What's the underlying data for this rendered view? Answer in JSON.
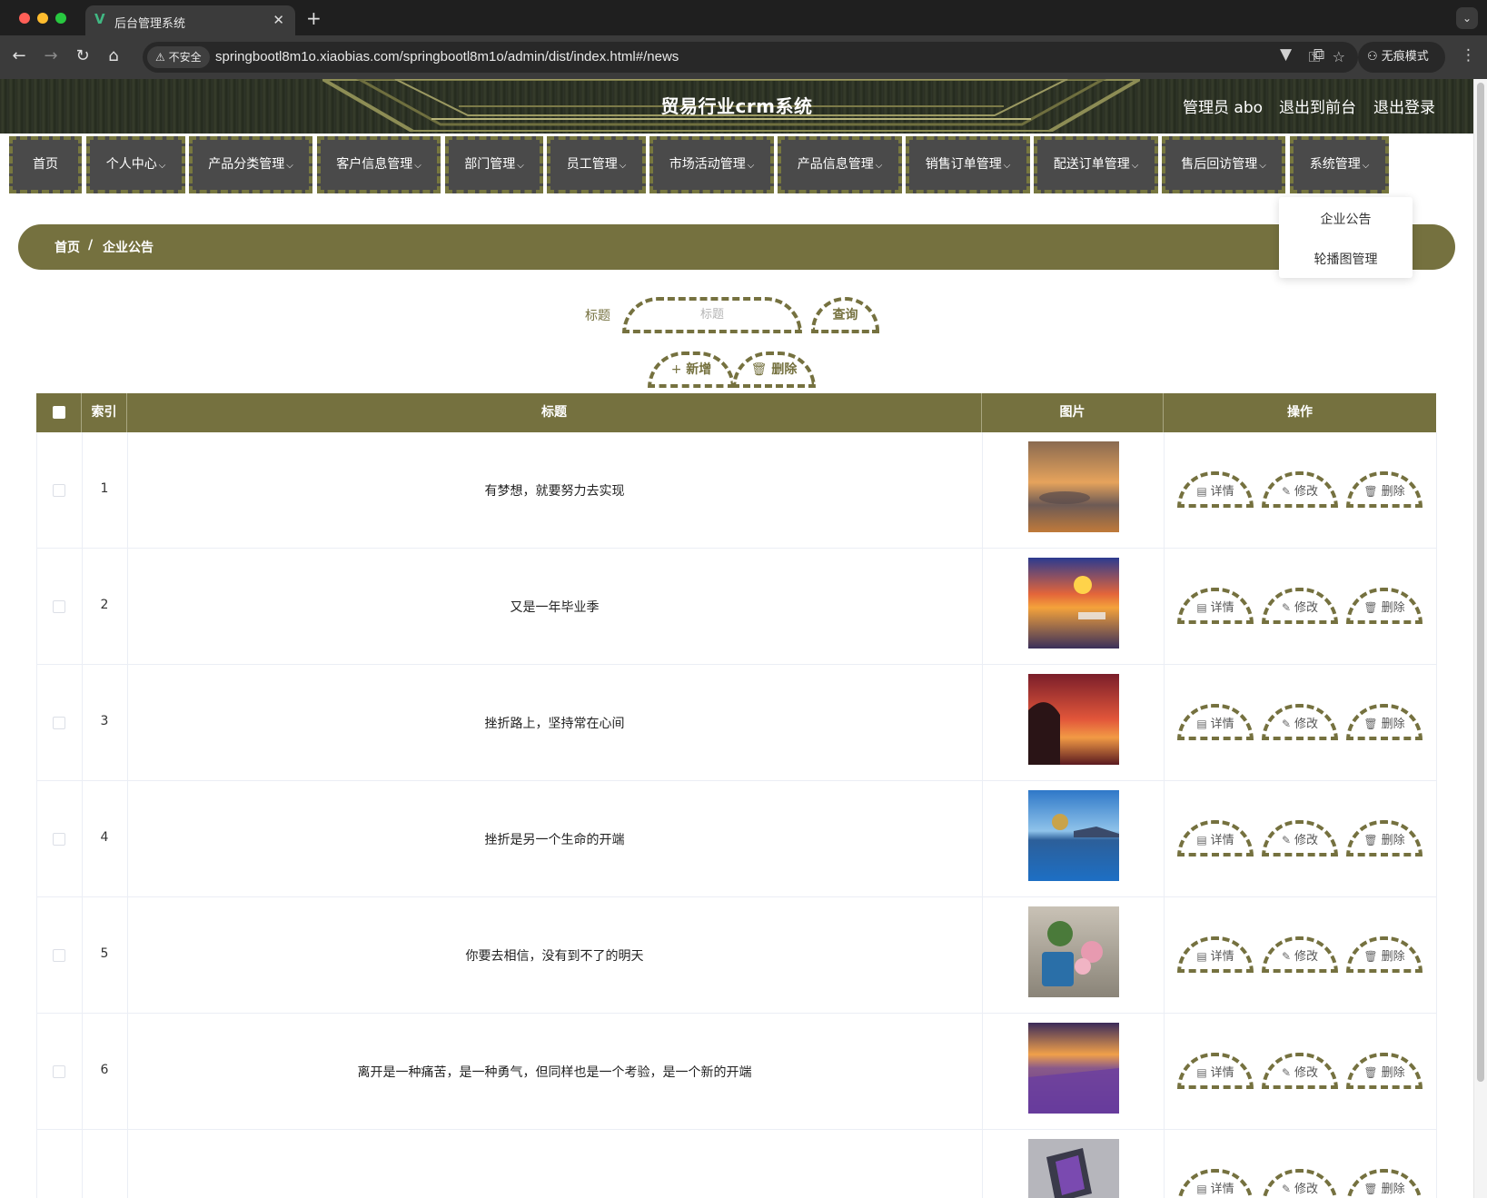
{
  "browser": {
    "tab_title": "后台管理系统",
    "tab_favicon": "V",
    "new_tab_symbol": "+",
    "insecure_label": "不安全",
    "url": "springbootl8m1o.xiaobias.com/springbootl8m1o/admin/dist/index.html#/news",
    "incognito_label": "无痕模式"
  },
  "header": {
    "title": "贸易行业crm系统",
    "user": "管理员 abo",
    "to_front": "退出到前台",
    "logout": "退出登录"
  },
  "menu": {
    "items": [
      {
        "label": "首页"
      },
      {
        "label": "个人中心"
      },
      {
        "label": "产品分类管理"
      },
      {
        "label": "客户信息管理"
      },
      {
        "label": "部门管理"
      },
      {
        "label": "员工管理"
      },
      {
        "label": "市场活动管理"
      },
      {
        "label": "产品信息管理"
      },
      {
        "label": "销售订单管理"
      },
      {
        "label": "配送订单管理"
      },
      {
        "label": "售后回访管理"
      },
      {
        "label": "系统管理"
      }
    ],
    "dropdown": [
      "企业公告",
      "轮播图管理"
    ]
  },
  "breadcrumb": {
    "home": "首页",
    "separator": "/",
    "current": "企业公告"
  },
  "search": {
    "label": "标题",
    "placeholder": "标题",
    "query_button": "查询"
  },
  "actions": {
    "add": "新增",
    "delete": "删除"
  },
  "table": {
    "columns": [
      "索引",
      "标题",
      "图片",
      "操作"
    ],
    "op_labels": {
      "detail": "详情",
      "edit": "修改",
      "delete": "删除"
    },
    "rows": [
      {
        "index": "1",
        "title": "有梦想，就要努力去实现"
      },
      {
        "index": "2",
        "title": "又是一年毕业季"
      },
      {
        "index": "3",
        "title": "挫折路上，坚持常在心间"
      },
      {
        "index": "4",
        "title": "挫折是另一个生命的开端"
      },
      {
        "index": "5",
        "title": "你要去相信，没有到不了的明天"
      },
      {
        "index": "6",
        "title": "离开是一种痛苦，是一种勇气，但同样也是一个考验，是一个新的开端"
      },
      {
        "index": "",
        "title": ""
      }
    ]
  },
  "colors": {
    "accent": "#75713f",
    "menu_bg": "#4a4a4a",
    "header_bg": "#2d3225"
  }
}
